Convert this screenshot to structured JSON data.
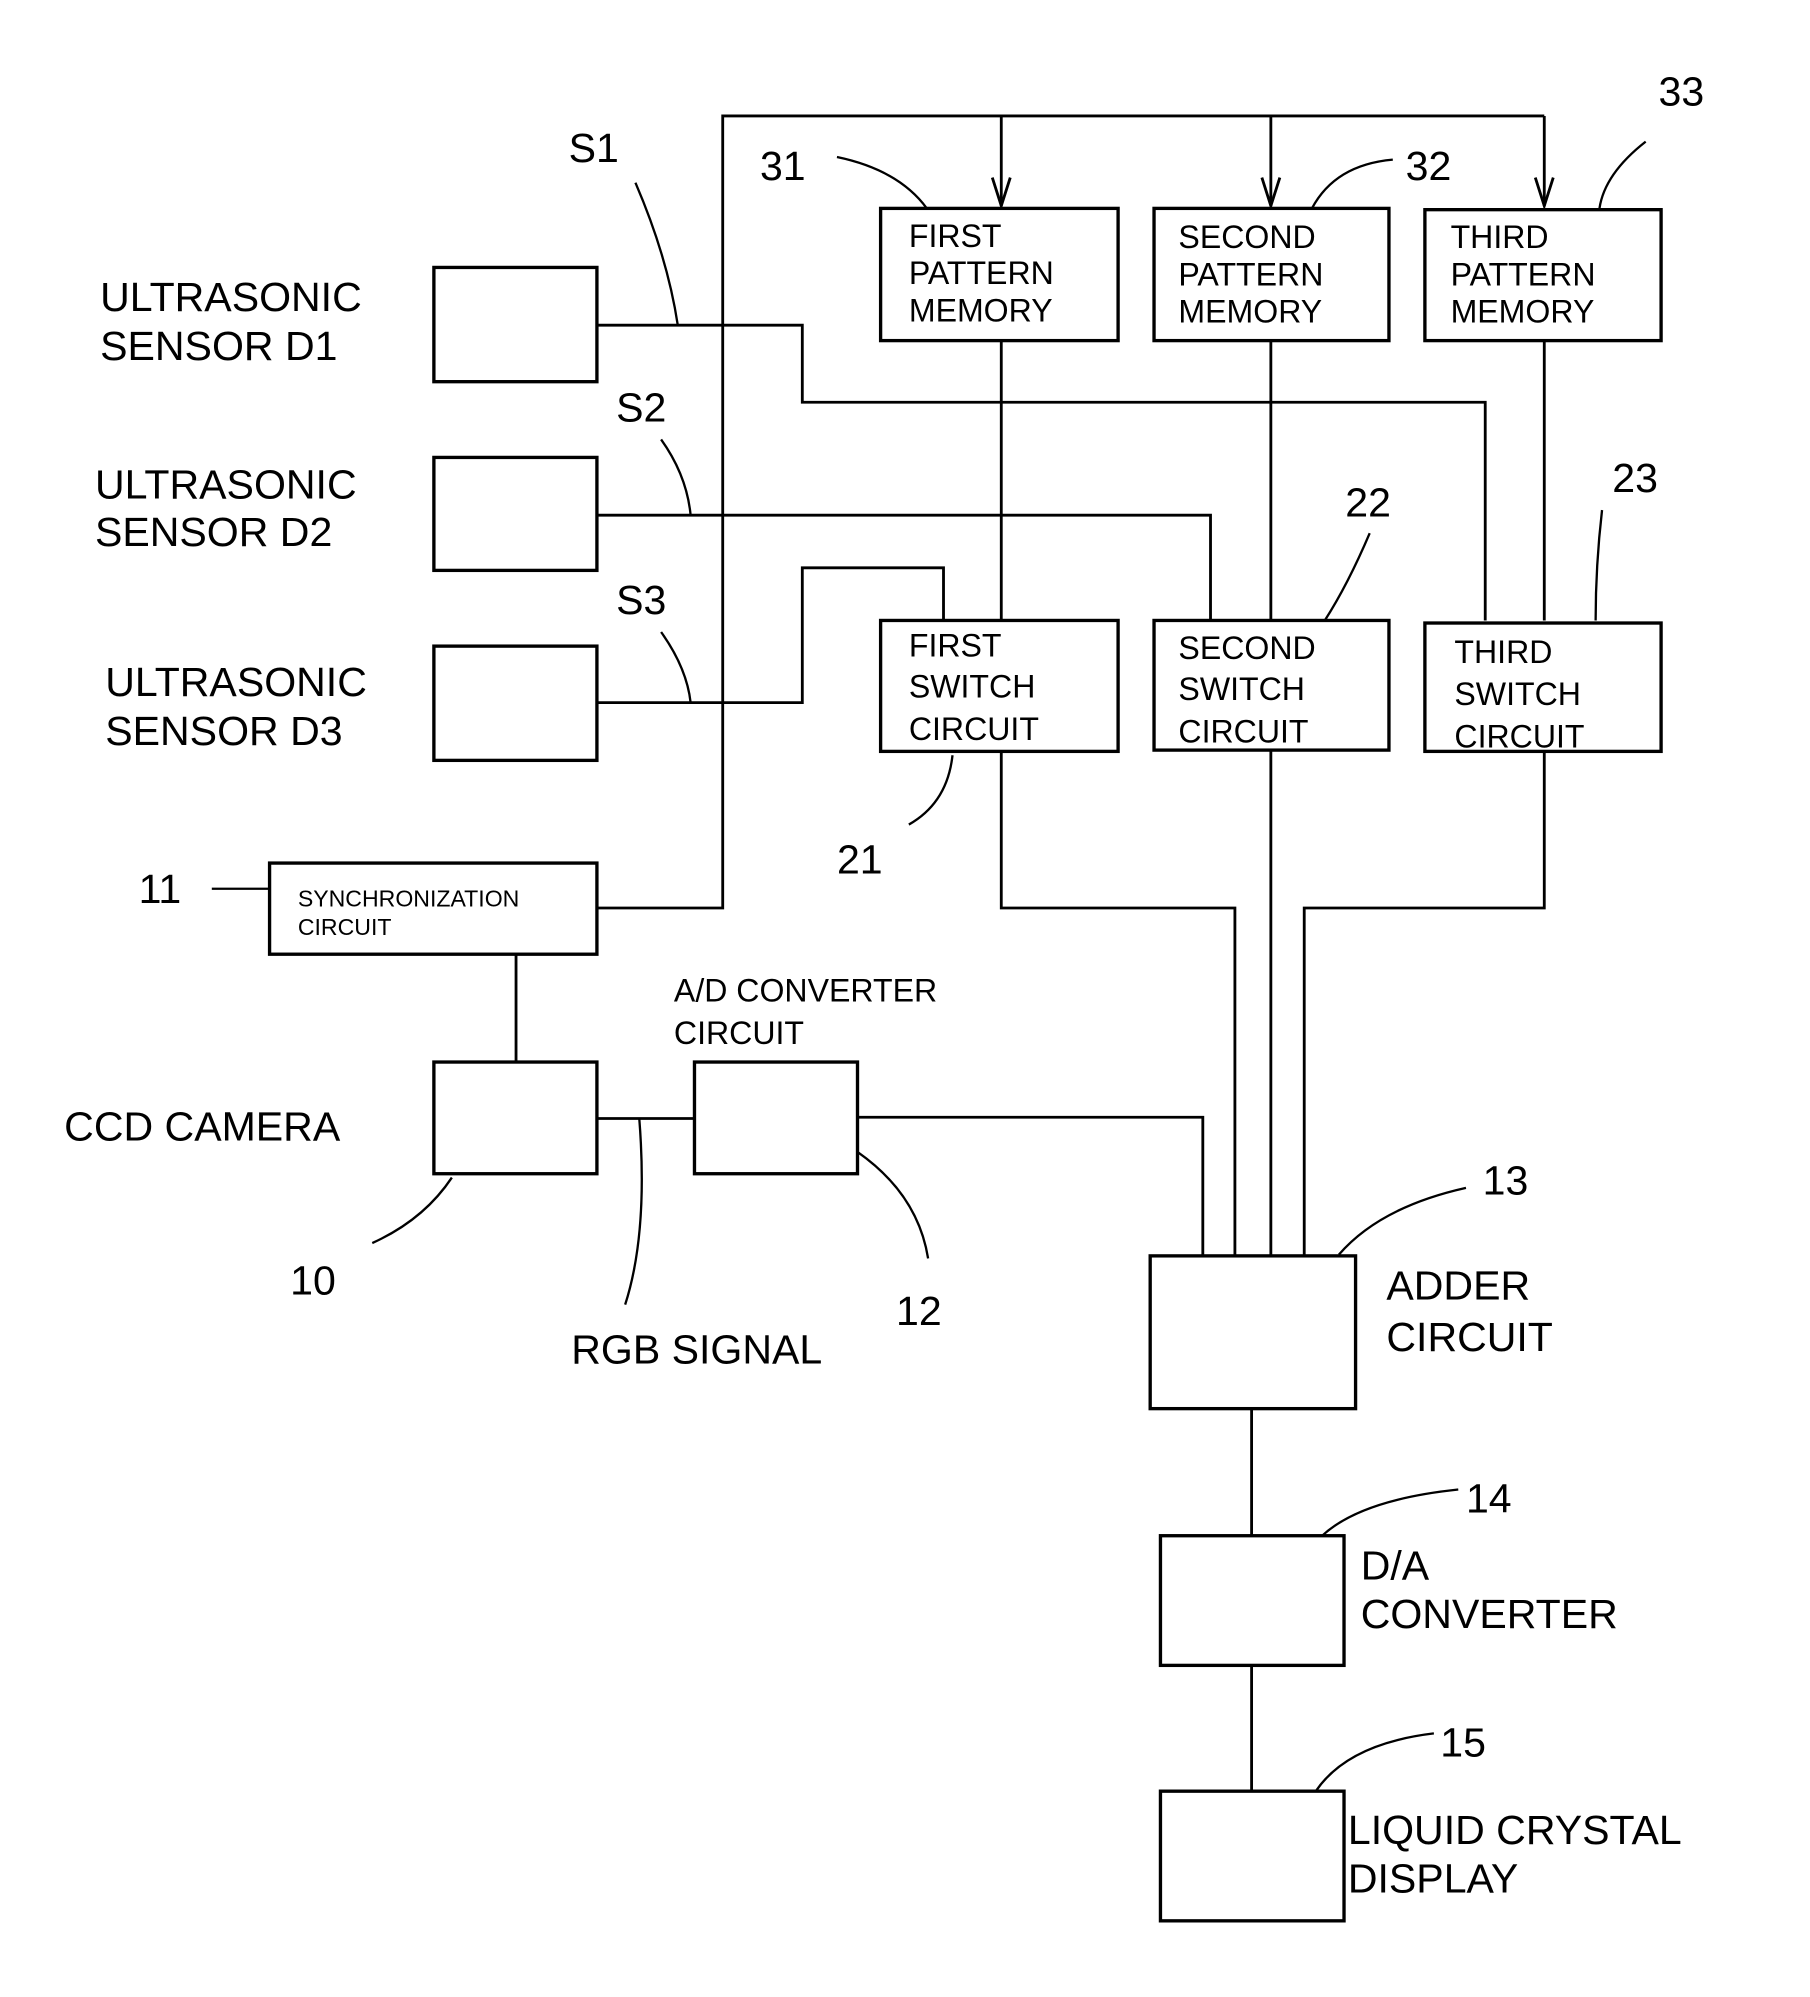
{
  "sensors": [
    {
      "line1": "ULTRASONIC",
      "line2": "SENSOR D1",
      "signal": "S1"
    },
    {
      "line1": "ULTRASONIC",
      "line2": "SENSOR D2",
      "signal": "S2"
    },
    {
      "line1": "ULTRASONIC",
      "line2": "SENSOR D3",
      "signal": "S3"
    }
  ],
  "memories": [
    {
      "ref": "31",
      "lines": [
        "FIRST",
        "PATTERN",
        "MEMORY"
      ]
    },
    {
      "ref": "32",
      "lines": [
        "SECOND",
        "PATTERN",
        "MEMORY"
      ]
    },
    {
      "ref": "33",
      "lines": [
        "THIRD",
        "PATTERN",
        "MEMORY"
      ]
    }
  ],
  "switches": [
    {
      "ref": "21",
      "lines": [
        "FIRST",
        "SWITCH",
        "CIRCUIT"
      ]
    },
    {
      "ref": "22",
      "lines": [
        "SECOND",
        "SWITCH",
        "CIRCUIT"
      ]
    },
    {
      "ref": "23",
      "lines": [
        "THIRD",
        "SWITCH",
        "CIRCUIT"
      ]
    }
  ],
  "sync": {
    "ref": "11",
    "line1": "SYNCHRONIZATION",
    "line2": "CIRCUIT"
  },
  "camera": {
    "ref": "10",
    "label": "CCD CAMERA"
  },
  "adc": {
    "ref": "12",
    "line1": "A/D CONVERTER",
    "line2": "CIRCUIT"
  },
  "rgb": {
    "label": "RGB SIGNAL"
  },
  "adder": {
    "ref": "13",
    "line1": "ADDER",
    "line2": "CIRCUIT"
  },
  "dac": {
    "ref": "14",
    "line1": "D/A",
    "line2": "CONVERTER"
  },
  "lcd": {
    "ref": "15",
    "line1": "LIQUID CRYSTAL",
    "line2": "DISPLAY"
  }
}
